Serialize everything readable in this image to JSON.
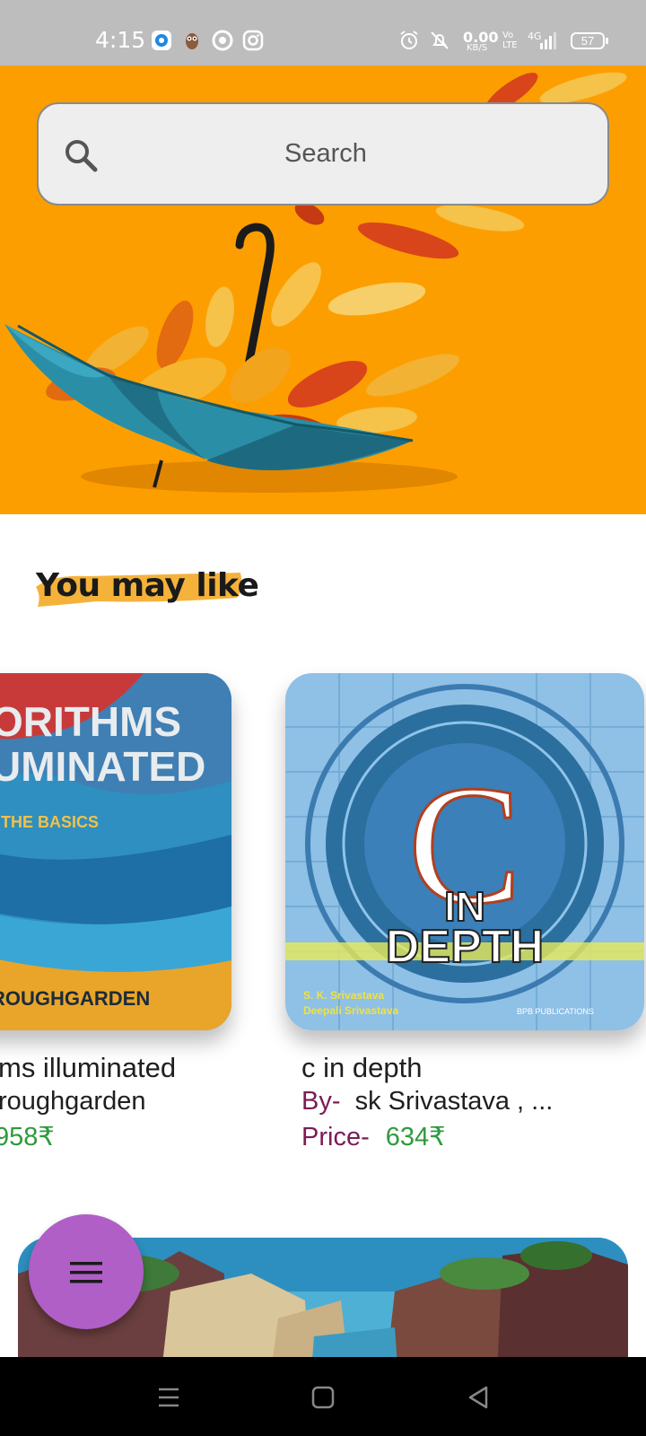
{
  "status_bar": {
    "time": "4:15",
    "net_speed": "0.00",
    "net_unit": "KB/S",
    "volte": "Vo LTE",
    "network": "4G",
    "battery": "57",
    "icons": [
      "messenger-icon",
      "owl-icon",
      "chrome-icon",
      "instagram-icon",
      "alarm-icon",
      "mute-icon",
      "signal-icon"
    ]
  },
  "search": {
    "placeholder": "Search"
  },
  "section": {
    "title": "You may like"
  },
  "books": [
    {
      "title": "ms illuminated",
      "author": "roughgarden",
      "price": "958₹",
      "cover_text": [
        "ORITHMS",
        "UMINATED",
        ": THE BASICS",
        "ROUGHGARDEN"
      ]
    },
    {
      "title": "c in depth",
      "author_label": "By-",
      "author": "sk Srivastava , ...",
      "price_label": "Price-",
      "price": "634₹",
      "cover_text": [
        "C",
        "IN",
        "DEPTH",
        "S. K. Srivastava",
        "Deepali Srivastava",
        "BPB PUBLICATIONS"
      ]
    }
  ],
  "colors": {
    "banner": "#fd9e00",
    "fab": "#b05fc6",
    "label": "#7b1c55",
    "price": "#2e9a3d"
  },
  "fab": {
    "icon": "menu-icon"
  },
  "nav": {
    "icons": [
      "recent-apps-icon",
      "home-icon",
      "back-icon"
    ]
  }
}
